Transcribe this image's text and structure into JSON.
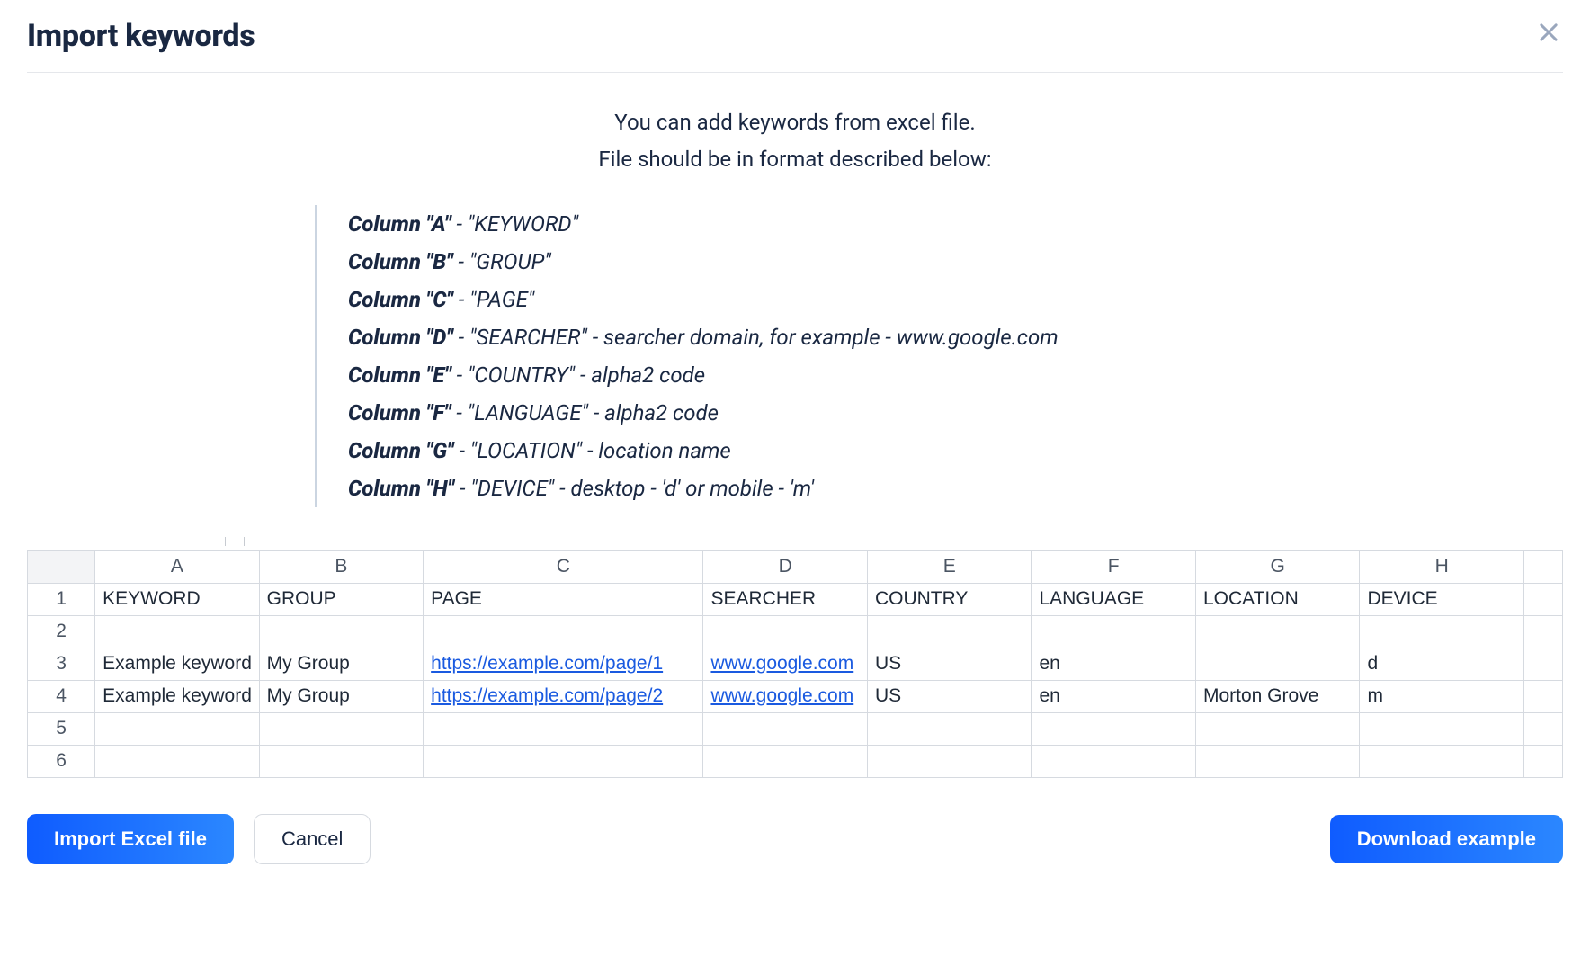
{
  "dialog": {
    "title": "Import keywords",
    "close_icon": "close-icon",
    "intro_line1": "You can add keywords from excel file.",
    "intro_line2": "File should be in format described below:"
  },
  "format": [
    {
      "column": "Column \"A\"",
      "desc": " - \"KEYWORD\""
    },
    {
      "column": "Column \"B\"",
      "desc": " - \"GROUP\""
    },
    {
      "column": "Column \"C\"",
      "desc": " - \"PAGE\""
    },
    {
      "column": "Column \"D\"",
      "desc": " - \"SEARCHER\" - searcher domain, for example - www.google.com"
    },
    {
      "column": "Column \"E\"",
      "desc": " - \"COUNTRY\" - alpha2 code"
    },
    {
      "column": "Column \"F\"",
      "desc": " - \"LANGUAGE\" - alpha2 code"
    },
    {
      "column": "Column \"G\"",
      "desc": " - \"LOCATION\" - location name"
    },
    {
      "column": "Column \"H\"",
      "desc": " - \"DEVICE\" - desktop - 'd' or mobile - 'm'"
    }
  ],
  "spreadsheet": {
    "column_letters": [
      "A",
      "B",
      "C",
      "D",
      "E",
      "F",
      "G",
      "H"
    ],
    "header_row": [
      "KEYWORD",
      "GROUP",
      "PAGE",
      "SEARCHER",
      "COUNTRY",
      "LANGUAGE",
      "LOCATION",
      "DEVICE"
    ],
    "rows": [
      {
        "num": "1",
        "cells": [
          "KEYWORD",
          "GROUP",
          "PAGE",
          "SEARCHER",
          "COUNTRY",
          "LANGUAGE",
          "LOCATION",
          "DEVICE"
        ],
        "links": {}
      },
      {
        "num": "2",
        "cells": [
          "",
          "",
          "",
          "",
          "",
          "",
          "",
          ""
        ],
        "links": {}
      },
      {
        "num": "3",
        "cells": [
          "Example keyword",
          "My Group",
          "https://example.com/page/1",
          "www.google.com",
          "US",
          "en",
          "",
          "d"
        ],
        "links": {
          "2": true,
          "3": true
        }
      },
      {
        "num": "4",
        "cells": [
          "Example keyword",
          "My Group",
          "https://example.com/page/2",
          "www.google.com",
          "US",
          "en",
          "Morton Grove",
          "m"
        ],
        "links": {
          "2": true,
          "3": true
        }
      },
      {
        "num": "5",
        "cells": [
          "",
          "",
          "",
          "",
          "",
          "",
          "",
          ""
        ],
        "links": {}
      },
      {
        "num": "6",
        "cells": [
          "",
          "",
          "",
          "",
          "",
          "",
          "",
          ""
        ],
        "links": {}
      }
    ]
  },
  "buttons": {
    "import": "Import Excel file",
    "cancel": "Cancel",
    "download": "Download example"
  }
}
